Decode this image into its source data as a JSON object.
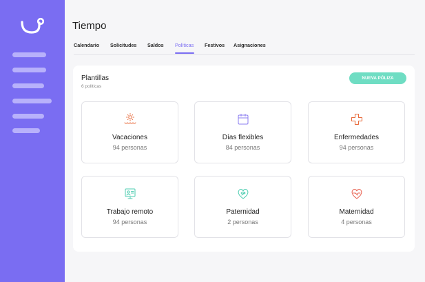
{
  "header": {
    "title": "Tiempo"
  },
  "tabs": [
    {
      "label": "Calendario"
    },
    {
      "label": "Solicitudes"
    },
    {
      "label": "Saldos"
    },
    {
      "label": "Políticas",
      "active": true
    },
    {
      "label": "Festivos"
    },
    {
      "label": "Asignaciones"
    }
  ],
  "templates": {
    "title": "Plantillas",
    "subtitle": "6 políticas",
    "new_button": "NUEVA PÓLIZA",
    "items": [
      {
        "name": "Vacaciones",
        "count": "94 personas",
        "icon": "sun-waves-icon",
        "color": "#e86d3f"
      },
      {
        "name": "Días flexibles",
        "count": "84 personas",
        "icon": "calendar-icon",
        "color": "#8b7cf0"
      },
      {
        "name": "Enfermedades",
        "count": "94 personas",
        "icon": "medical-cross-icon",
        "color": "#e86d3f"
      },
      {
        "name": "Trabajo remoto",
        "count": "94 personas",
        "icon": "remote-screen-icon",
        "color": "#4ecdb0"
      },
      {
        "name": "Paternidad",
        "count": "2 personas",
        "icon": "heart-leaf-icon",
        "color": "#4ecdb0"
      },
      {
        "name": "Maternidad",
        "count": "4 personas",
        "icon": "heart-handshake-icon",
        "color": "#e8604f"
      }
    ]
  },
  "colors": {
    "sidebar": "#7a6df2",
    "accent": "#7a6df2",
    "button": "#6fddc3"
  }
}
